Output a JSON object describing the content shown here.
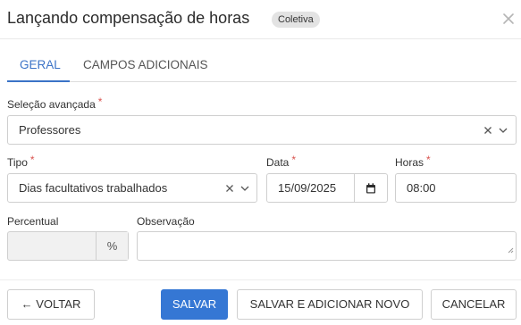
{
  "dialog": {
    "title": "Lançando compensação de horas",
    "badge": "Coletiva"
  },
  "tabs": [
    {
      "label": "GERAL",
      "active": true
    },
    {
      "label": "CAMPOS ADICIONAIS",
      "active": false
    }
  ],
  "form": {
    "selecao": {
      "label": "Seleção avançada",
      "required_mark": "*",
      "value": "Professores"
    },
    "tipo": {
      "label": "Tipo",
      "required_mark": "*",
      "value": "Dias facultativos trabalhados"
    },
    "data": {
      "label": "Data",
      "required_mark": "*",
      "value": "15/09/2025"
    },
    "horas": {
      "label": "Horas",
      "required_mark": "*",
      "value": "08:00"
    },
    "percentual": {
      "label": "Percentual",
      "value": "",
      "unit": "%"
    },
    "observacao": {
      "label": "Observação",
      "value": ""
    }
  },
  "footer": {
    "back_label": "← VOLTAR",
    "save_label": "SALVAR",
    "save_new_label": "SALVAR E ADICIONAR NOVO",
    "cancel_label": "CANCELAR"
  },
  "colors": {
    "accent": "#3b73c7",
    "primary_button": "#3577d4",
    "required": "#d9534f"
  }
}
